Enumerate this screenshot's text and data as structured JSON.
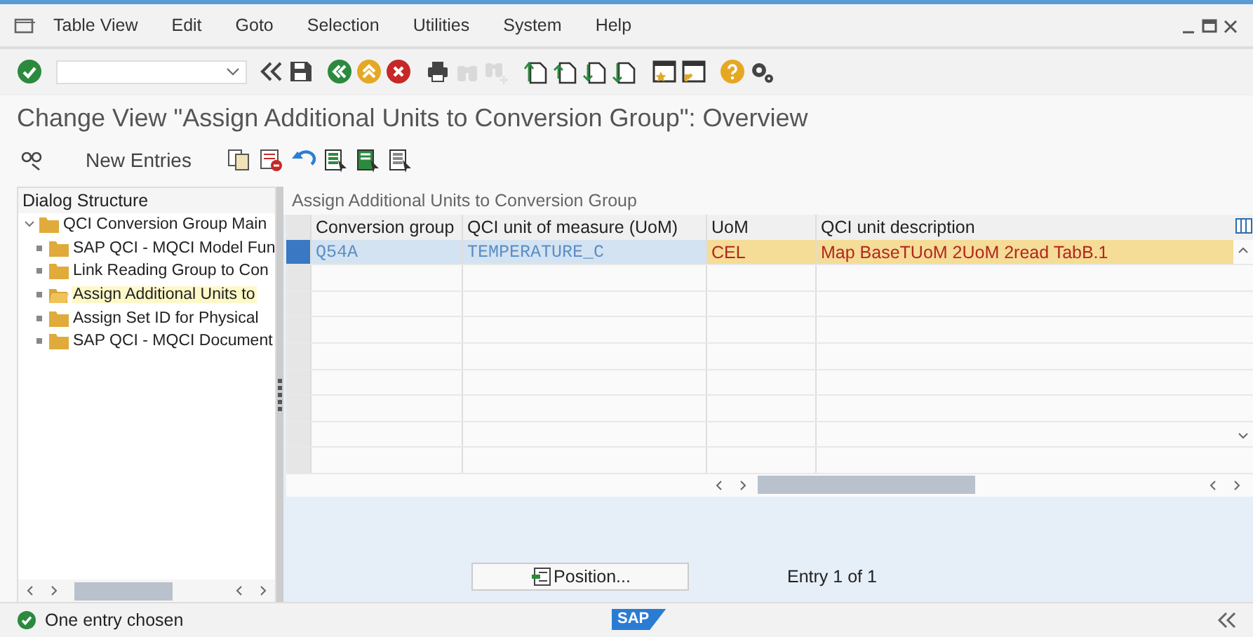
{
  "menu": [
    {
      "label": "Table View"
    },
    {
      "label": "Edit"
    },
    {
      "label": "Goto"
    },
    {
      "label": "Selection"
    },
    {
      "label": "Utilities"
    },
    {
      "label": "System"
    },
    {
      "label": "Help"
    }
  ],
  "toolbar": [
    {
      "kind": "enter",
      "disabled": false
    },
    {
      "kind": "command",
      "disabled": false
    },
    {
      "kind": "collapse",
      "disabled": false
    },
    {
      "kind": "save",
      "disabled": false
    },
    {
      "kind": "back",
      "disabled": false
    },
    {
      "kind": "exit",
      "disabled": false
    },
    {
      "kind": "cancel",
      "disabled": false
    },
    {
      "kind": "print",
      "disabled": false
    },
    {
      "kind": "find",
      "disabled": true
    },
    {
      "kind": "findnext",
      "disabled": true
    },
    {
      "kind": "first",
      "disabled": false
    },
    {
      "kind": "prev",
      "disabled": false
    },
    {
      "kind": "next",
      "disabled": false
    },
    {
      "kind": "last",
      "disabled": false
    },
    {
      "kind": "session",
      "disabled": false
    },
    {
      "kind": "shortcut",
      "disabled": false
    },
    {
      "kind": "help",
      "disabled": false
    },
    {
      "kind": "settings",
      "disabled": false
    }
  ],
  "title": "Change View \"Assign Additional Units to Conversion Group\": Overview",
  "app_toolbar": [
    {
      "kind": "toggle"
    },
    {
      "kind": "text",
      "label": "New Entries"
    },
    {
      "kind": "copy"
    },
    {
      "kind": "delete"
    },
    {
      "kind": "undo"
    },
    {
      "kind": "selectall"
    },
    {
      "kind": "selectblock"
    },
    {
      "kind": "deselect"
    }
  ],
  "dialog_structure": {
    "title": "Dialog Structure",
    "items": [
      {
        "label": "QCI Conversion Group Main",
        "selected": false,
        "expanded": true,
        "children": [
          {
            "label": "SAP QCI - MQCI Model Fun",
            "selected": false
          },
          {
            "label": "Link Reading Group to Con",
            "selected": false
          },
          {
            "label": "Assign Additional Units to",
            "selected": true
          },
          {
            "label": "Assign Set ID for Physical",
            "selected": false
          },
          {
            "label": "SAP QCI - MQCI Document",
            "selected": false
          }
        ]
      }
    ]
  },
  "table": {
    "title": "Assign Additional Units to Conversion Group",
    "columns": [
      {
        "label": "Conversion group",
        "key": true
      },
      {
        "label": "QCI unit of measure (UoM)",
        "key": true
      },
      {
        "label": "UoM",
        "key": false
      },
      {
        "label": "QCI unit description",
        "key": false
      }
    ],
    "rows": [
      {
        "selected": true,
        "cells": [
          "Q54A",
          "TEMPERATURE_C",
          "CEL",
          "Map BaseTUoM 2UoM 2read TabB.1"
        ]
      }
    ]
  },
  "position_button": "Position...",
  "entry_count": "Entry 1 of 1",
  "status_bar": {
    "message": "One entry chosen",
    "logo": "SAP"
  }
}
